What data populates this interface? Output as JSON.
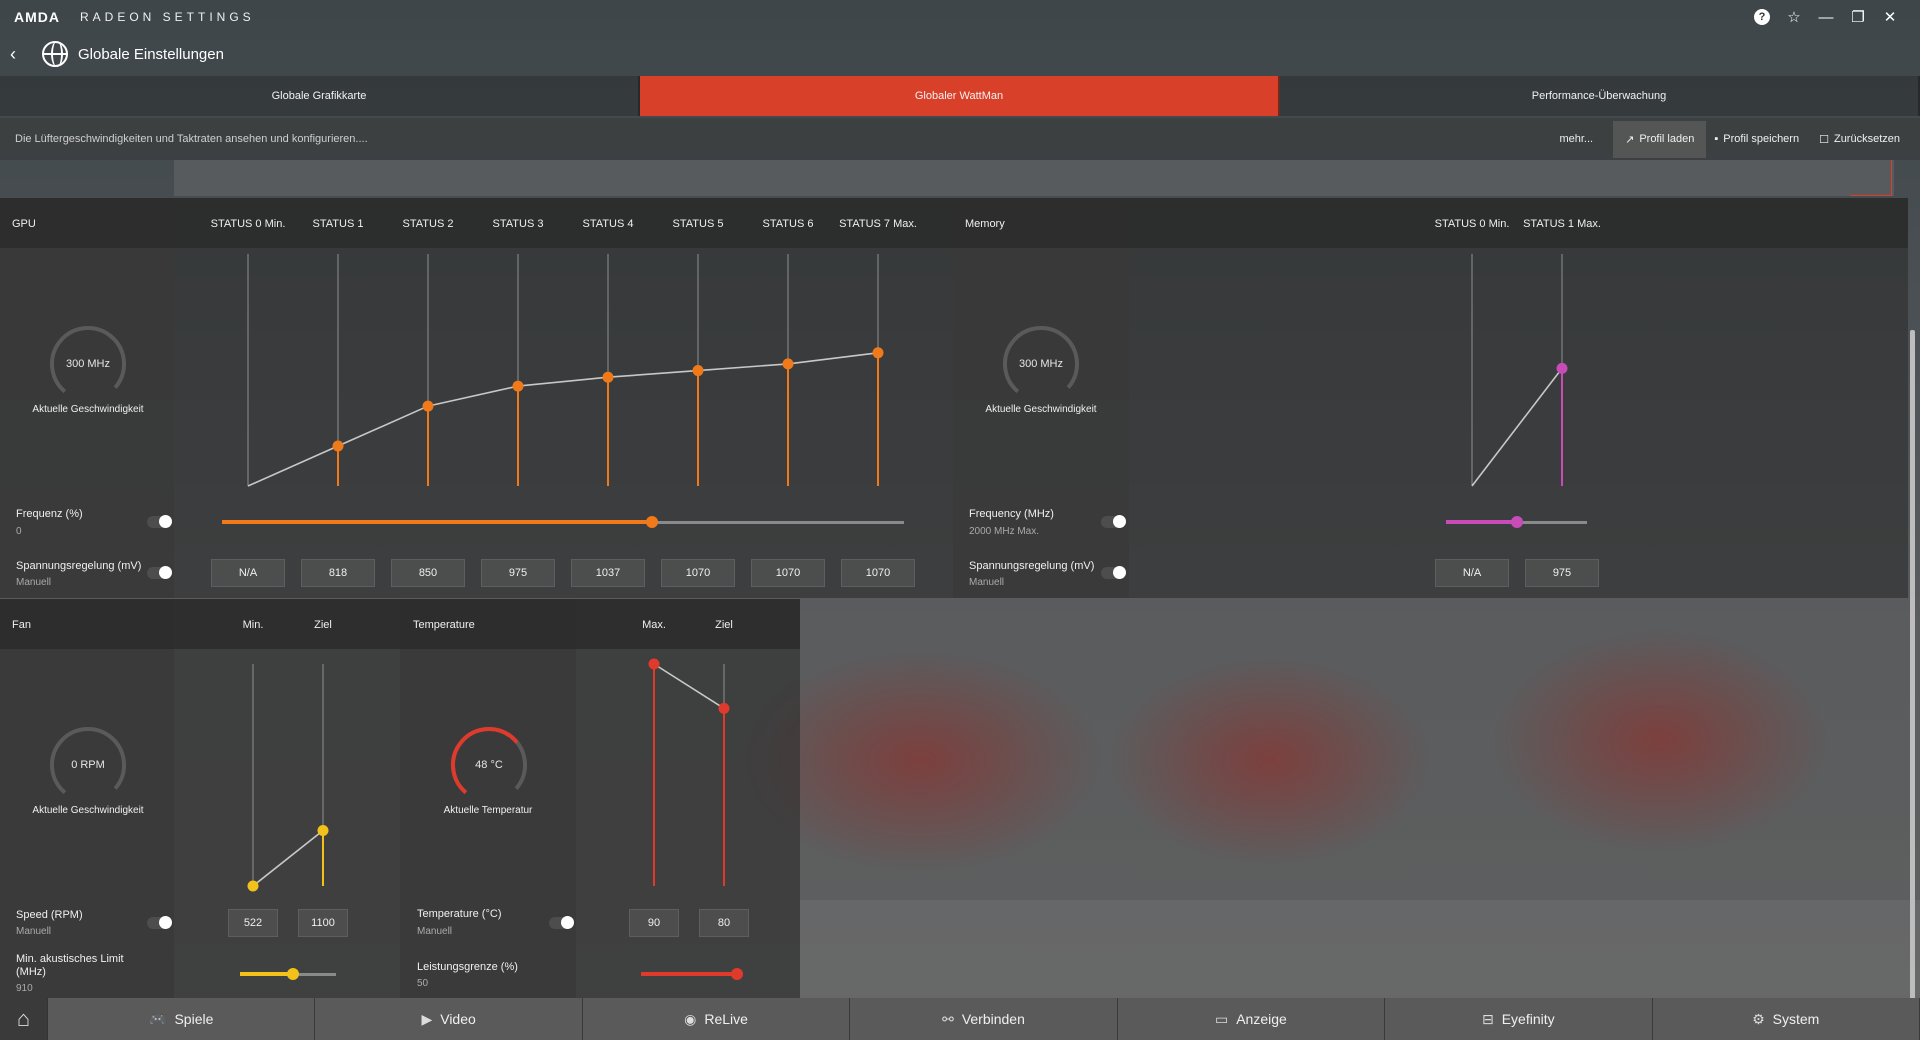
{
  "app": {
    "brand": "AMDA",
    "name": "RADEON SETTINGS"
  },
  "window_icons": [
    "help-icon",
    "star-icon",
    "minimize-icon",
    "restore-icon",
    "close-icon"
  ],
  "window": {
    "help_label": "?",
    "star_label": "☆",
    "minimize_label": "—",
    "restore_label": "❐",
    "close_label": "✕"
  },
  "header": {
    "title": "Globale Einstellungen"
  },
  "tabs": [
    {
      "label": "Globale Grafikkarte",
      "active": false
    },
    {
      "label": "Globaler WattMan",
      "active": true
    },
    {
      "label": "Performance-Überwachung",
      "active": false
    }
  ],
  "toolbar": {
    "description": "Die Lüftergeschwindigkeiten und Taktraten ansehen und konfigurieren....",
    "more": "mehr...",
    "load_profile": "Profil laden",
    "save_profile": "Profil speichern",
    "reset": "Zurücksetzen"
  },
  "gpu": {
    "title": "GPU",
    "states": [
      "STATUS 0 Min.",
      "STATUS 1",
      "STATUS 2",
      "STATUS 3",
      "STATUS 4",
      "STATUS 5",
      "STATUS 6",
      "STATUS 7 Max."
    ],
    "state_levels": [
      0,
      0.18,
      0.36,
      0.45,
      0.49,
      0.52,
      0.55,
      0.6
    ],
    "gauge_value": "300 MHz",
    "gauge_caption": "Aktuelle Geschwindigkeit",
    "frequency_label": "Frequenz (%)",
    "frequency_value": "0",
    "frequency_slider": 0.63,
    "voltage_label": "Spannungsregelung (mV)",
    "voltage_mode": "Manuell",
    "voltages": [
      "N/A",
      "818",
      "850",
      "975",
      "1037",
      "1070",
      "1070",
      "1070"
    ],
    "accent": "#f07a1a"
  },
  "memory": {
    "title": "Memory",
    "states": [
      "STATUS 0 Min.",
      "STATUS 1 Max."
    ],
    "state_levels": [
      0,
      0.53
    ],
    "gauge_value": "300 MHz",
    "gauge_caption": "Aktuelle Geschwindigkeit",
    "frequency_label": "Frequency (MHz)",
    "frequency_value": "2000 MHz Max.",
    "frequency_slider": 0.5,
    "voltage_label": "Spannungsregelung (mV)",
    "voltage_mode": "Manuell",
    "voltages": [
      "N/A",
      "975"
    ],
    "accent": "#c84bb8"
  },
  "fan": {
    "title": "Fan",
    "columns": [
      "Min.",
      "Ziel"
    ],
    "levels": [
      0,
      0.25
    ],
    "gauge_value": "0 RPM",
    "gauge_caption": "Aktuelle Geschwindigkeit",
    "speed_label": "Speed (RPM)",
    "speed_mode": "Manuell",
    "speeds": [
      "522",
      "1100"
    ],
    "acoustic_label": "Min. akustisches Limit (MHz)",
    "acoustic_value": "910",
    "acoustic_slider": 0.55,
    "accent": "#f2c21a"
  },
  "temperature": {
    "title": "Temperature",
    "columns": [
      "Max.",
      "Ziel"
    ],
    "levels": [
      1,
      0.8
    ],
    "gauge_value": "48 °C",
    "gauge_caption": "Aktuelle Temperatur",
    "temp_label": "Temperature (°C)",
    "temp_mode": "Manuell",
    "temps": [
      "90",
      "80"
    ],
    "power_label": "Leistungsgrenze (%)",
    "power_value": "50",
    "power_slider": 1.0,
    "accent": "#e03a2c"
  },
  "bottom_nav": [
    {
      "label": "Spiele",
      "icon": "gamepad-icon",
      "glyph": "🎮"
    },
    {
      "label": "Video",
      "icon": "play-icon",
      "glyph": "▶"
    },
    {
      "label": "ReLive",
      "icon": "relive-icon",
      "glyph": "◉"
    },
    {
      "label": "Verbinden",
      "icon": "share-icon",
      "glyph": "⚯"
    },
    {
      "label": "Anzeige",
      "icon": "monitor-icon",
      "glyph": "▭"
    },
    {
      "label": "Eyefinity",
      "icon": "eyefinity-icon",
      "glyph": "⊟"
    },
    {
      "label": "System",
      "icon": "system-icon",
      "glyph": "⚙"
    }
  ],
  "home": {
    "icon": "home-icon",
    "glyph": "⌂"
  }
}
